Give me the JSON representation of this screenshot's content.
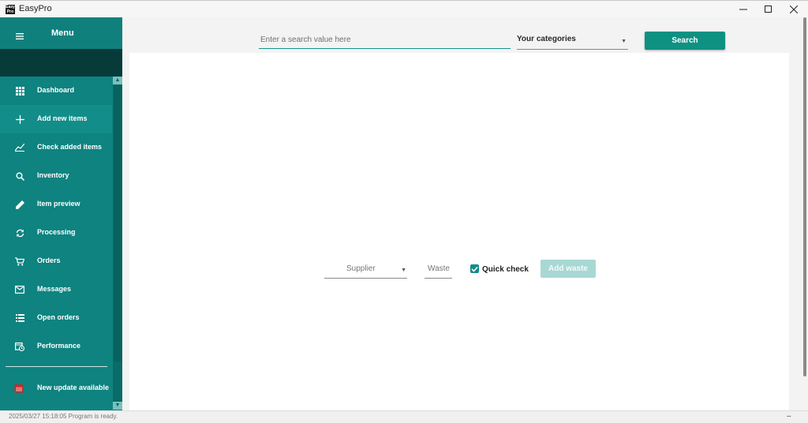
{
  "window": {
    "title": "EasyPro",
    "logo_text": "Easy Pro",
    "controls": {
      "minimize": "minimize-icon",
      "maximize": "maximize-icon",
      "close": "close-icon"
    }
  },
  "sidebar": {
    "menu_label": "Menu",
    "items": [
      {
        "label": "Dashboard",
        "icon": "grid-icon"
      },
      {
        "label": "Add new items",
        "icon": "plus-icon",
        "active": true
      },
      {
        "label": "Check added items",
        "icon": "check-icon"
      },
      {
        "label": "Inventory",
        "icon": "search-icon"
      },
      {
        "label": "Item preview",
        "icon": "pencil-icon"
      },
      {
        "label": "Processing",
        "icon": "refresh-icon"
      },
      {
        "label": "Orders",
        "icon": "cart-icon"
      },
      {
        "label": "Messages",
        "icon": "mail-icon"
      },
      {
        "label": "Open orders",
        "icon": "list-icon"
      },
      {
        "label": "Performance",
        "icon": "calendar-clock-icon"
      }
    ],
    "update_label": "New update available",
    "update_icon": "calendar-icon"
  },
  "search": {
    "placeholder": "Enter a search value here",
    "value": "",
    "category_label": "Your categories",
    "button_label": "Search"
  },
  "waste_form": {
    "supplier_label": "Supplier",
    "waste_label": "Waste",
    "quick_check_label": "Quick check",
    "quick_check_checked": true,
    "add_button_label": "Add waste"
  },
  "status": {
    "text": "2025/03/27 15:18:05 Program is ready.",
    "more": "..."
  },
  "colors": {
    "sidebar": "#0e8380",
    "sidebar_dark": "#063b3a",
    "accent": "#0f9182",
    "disabled_button": "#a8d8d4",
    "update_icon": "#c62828"
  }
}
